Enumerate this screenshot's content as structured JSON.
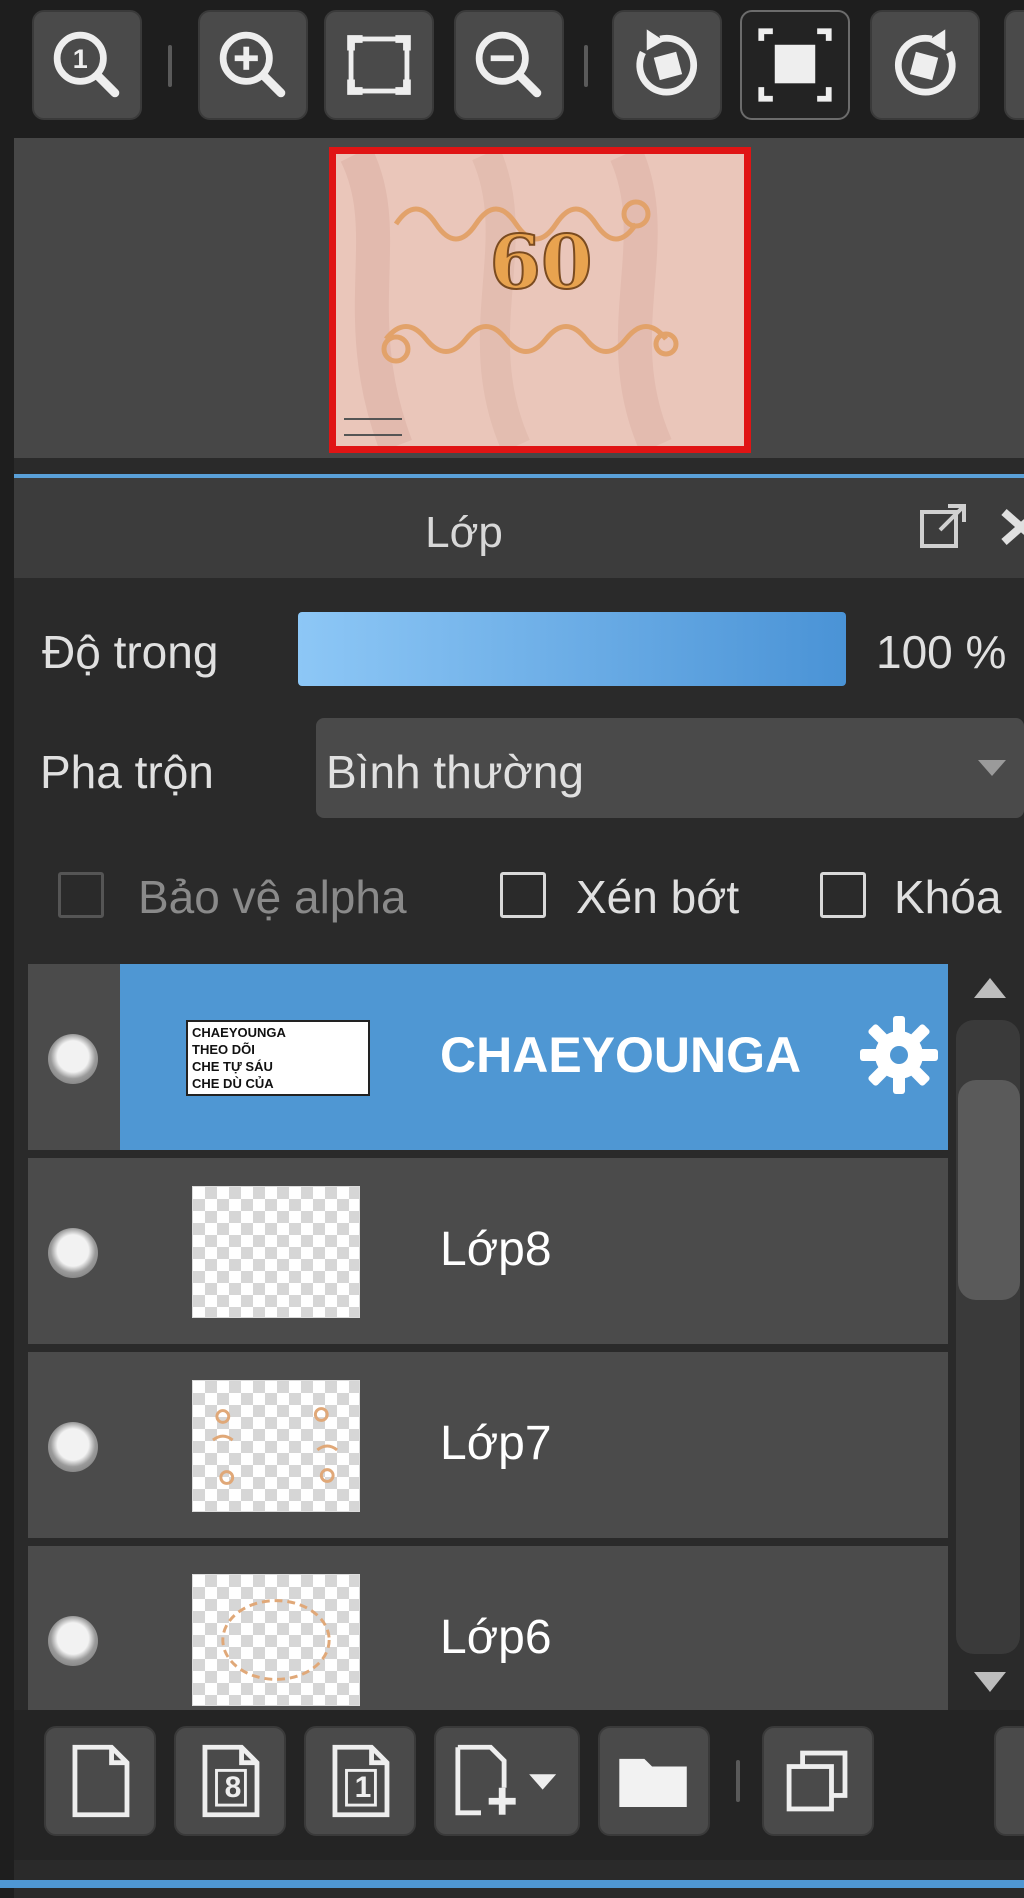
{
  "toolbar": {
    "buttons": [
      {
        "name": "zoom-actual-size",
        "icon": "zoom-one-icon"
      },
      {
        "name": "zoom-in",
        "icon": "zoom-in-icon"
      },
      {
        "name": "fit-to-window",
        "icon": "fit-screen-icon"
      },
      {
        "name": "zoom-out",
        "icon": "zoom-out-icon"
      },
      {
        "name": "rotate-left",
        "icon": "rotate-left-icon"
      },
      {
        "name": "reset-view",
        "icon": "reset-view-icon"
      },
      {
        "name": "rotate-right",
        "icon": "rotate-right-icon"
      }
    ]
  },
  "navigator": {
    "preview_text": "60"
  },
  "panel": {
    "title": "Lớp",
    "popout_icon": "popout-icon",
    "close_icon": "close-icon"
  },
  "opacity": {
    "label": "Độ trong",
    "value_text": "100 %",
    "fraction": 1.0
  },
  "blend": {
    "label": "Pha trộn",
    "value": "Bình thường"
  },
  "options": {
    "protect_alpha": {
      "label": "Bảo vệ alpha",
      "checked": false,
      "disabled": true
    },
    "clipping": {
      "label": "Xén bớt",
      "checked": false
    },
    "lock": {
      "label": "Khóa",
      "checked": false
    }
  },
  "layers": [
    {
      "name": "CHAEYOUNGA",
      "selected": true,
      "thumb": "text",
      "thumb_text": [
        "CHAEYOUNGA",
        "THEO DÕI",
        "CHE TỰ SÁU",
        "CHE DÙ CỦA"
      ]
    },
    {
      "name": "Lớp8",
      "selected": false,
      "thumb": "empty"
    },
    {
      "name": "Lớp7",
      "selected": false,
      "thumb": "dots"
    },
    {
      "name": "Lớp6",
      "selected": false,
      "thumb": "ring"
    }
  ],
  "bottom_toolbar": {
    "buttons": [
      {
        "name": "new-layer",
        "icon": "new-page-icon"
      },
      {
        "name": "new-8bit-layer",
        "icon": "new-8bit-layer-icon",
        "label": "8"
      },
      {
        "name": "new-1bit-layer",
        "icon": "new-1bit-layer-icon",
        "label": "1"
      },
      {
        "name": "add-layer-menu",
        "icon": "add-layer-dropdown-icon"
      },
      {
        "name": "new-folder",
        "icon": "folder-icon"
      },
      {
        "name": "duplicate-layer",
        "icon": "duplicate-icon"
      }
    ]
  },
  "colors": {
    "selection": "#4f97d3",
    "accent": "#5aa0d8",
    "navigator_frame": "#e01414",
    "panel_bg": "#2a2a2a"
  }
}
